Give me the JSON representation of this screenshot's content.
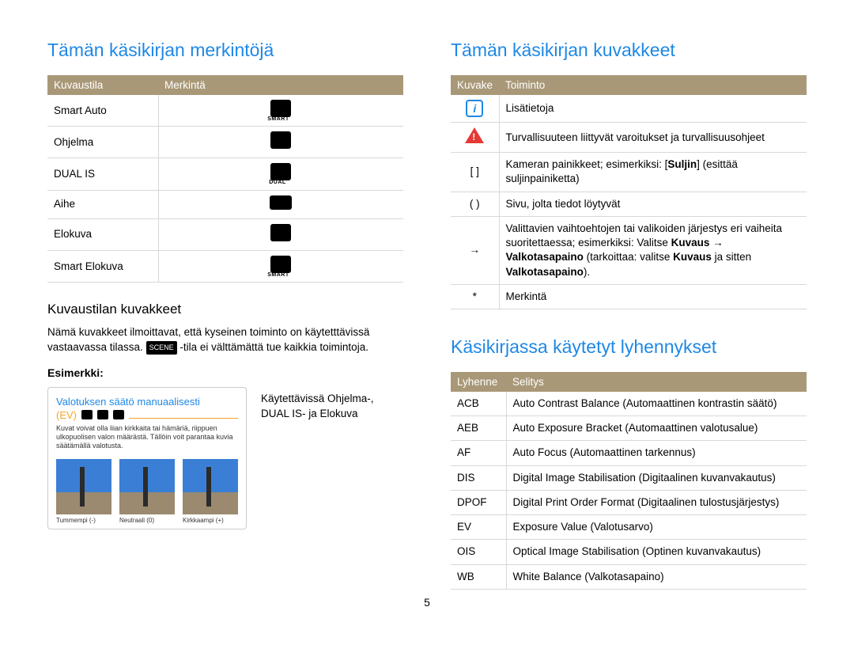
{
  "left": {
    "title": "Tämän käsikirjan merkintöjä",
    "modes_header": {
      "c1": "Kuvaustila",
      "c2": "Merkintä"
    },
    "modes": [
      {
        "label": "Smart Auto"
      },
      {
        "label": "Ohjelma"
      },
      {
        "label": "DUAL IS"
      },
      {
        "label": "Aihe"
      },
      {
        "label": "Elokuva"
      },
      {
        "label": "Smart Elokuva"
      }
    ],
    "sub_title": "Kuvaustilan kuvakkeet",
    "desc_a": "Nämä kuvakkeet ilmoittavat, että kyseinen toiminto on käytetttävissä vastaavassa tilassa. ",
    "desc_b": "-tila ei välttämättä tue kaikkia toimintoja.",
    "example_label": "Esimerkki:",
    "example_title": "Valotuksen säätö manuaalisesti",
    "ev_label": "(EV)",
    "example_caption": "Kuvat voivat olla liian kirkkaita tai hämäriä, riippuen ulkopuolisen valon määrästä. Tällöin voit parantaa kuvia säätämällä valotusta.",
    "thumbs": [
      {
        "label": "Tummempi (-)"
      },
      {
        "label": "Neutraali (0)"
      },
      {
        "label": "Kirkkaampi (+)"
      }
    ],
    "example_side": "Käytettävissä Ohjelma-, DUAL IS- ja Elokuva"
  },
  "right": {
    "title1": "Tämän käsikirjan kuvakkeet",
    "icons_header": {
      "c1": "Kuvake",
      "c2": "Toiminto"
    },
    "icons": [
      {
        "sym": "note",
        "text_plain": "Lisätietoja"
      },
      {
        "sym": "warn",
        "text_plain": "Turvallisuuteen liittyvät varoitukset ja turvallisuusohjeet"
      },
      {
        "sym": "[ ]",
        "text_a": "Kameran painikkeet; esimerkiksi: [",
        "text_b": "Suljin",
        "text_c": "] (esittää suljinpainiketta)"
      },
      {
        "sym": "( )",
        "text_plain": "Sivu, jolta tiedot löytyvät"
      },
      {
        "sym": "→",
        "text_a": "Valittavien vaihtoehtojen tai valikoiden järjestys eri vaiheita suoritettaessa; esimerkiksi: Valitse ",
        "text_b": "Kuvaus",
        "text_c": " → ",
        "text_d": "Valkotasapaino",
        "text_e": " (tarkoittaa: valitse ",
        "text_f": "Kuvaus",
        "text_g": " ja sitten ",
        "text_h": "Valkotasapaino",
        "text_i": ")."
      },
      {
        "sym": "*",
        "text_plain": "Merkintä"
      }
    ],
    "title2": "Käsikirjassa käytetyt lyhennykset",
    "abbrev_header": {
      "c1": "Lyhenne",
      "c2": "Selitys"
    },
    "abbrev": [
      {
        "a": "ACB",
        "d": "Auto Contrast Balance (Automaattinen kontrastin säätö)"
      },
      {
        "a": "AEB",
        "d": "Auto Exposure Bracket (Automaattinen valotusalue)"
      },
      {
        "a": "AF",
        "d": "Auto Focus (Automaattinen tarkennus)"
      },
      {
        "a": "DIS",
        "d": "Digital Image Stabilisation (Digitaalinen kuvanvakautus)"
      },
      {
        "a": "DPOF",
        "d": "Digital Print Order Format (Digitaalinen tulostusjärjestys)"
      },
      {
        "a": "EV",
        "d": "Exposure Value (Valotusarvo)"
      },
      {
        "a": "OIS",
        "d": "Optical Image Stabilisation (Optinen kuvanvakautus)"
      },
      {
        "a": "WB",
        "d": "White Balance (Valkotasapaino)"
      }
    ]
  },
  "page_number": "5"
}
